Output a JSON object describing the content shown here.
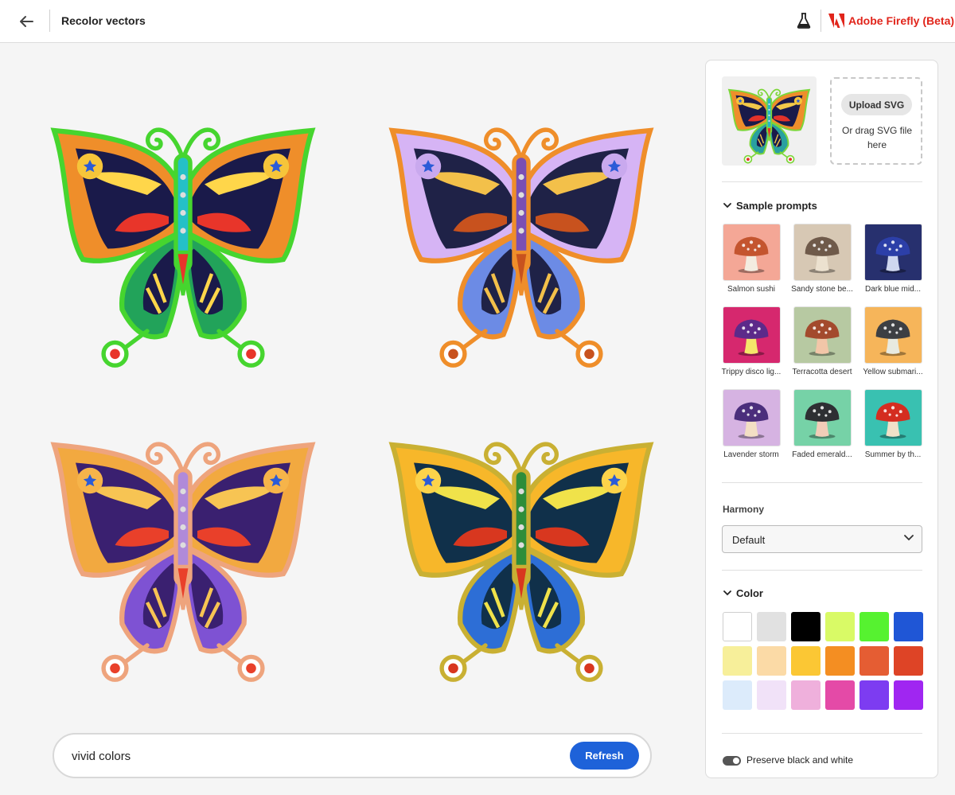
{
  "header": {
    "title": "Recolor vectors",
    "brand": "Adobe Firefly (Beta)",
    "brand_color": "#e1251b"
  },
  "icons": {
    "back": "arrow-left-icon",
    "labs": "flask-icon",
    "brand": "adobe-logo-icon",
    "section": "chevron-down-icon",
    "select": "chevron-down-icon"
  },
  "results": [
    {
      "outline": "#46d52f",
      "wing": "#ef8e2a",
      "dark": "#1a1a4a",
      "accent": "#e8352a",
      "lower": "#22a35a",
      "stripe": "#ffd64a",
      "body": "#25c0c7",
      "alt": "#f6c53a"
    },
    {
      "outline": "#ef8e2a",
      "wing": "#d6b4f5",
      "dark": "#1f2247",
      "accent": "#c8521e",
      "lower": "#6c8be5",
      "stripe": "#f3c04a",
      "body": "#7a4fb3",
      "alt": "#c9a9ee"
    },
    {
      "outline": "#eea47d",
      "wing": "#f2a940",
      "dark": "#3a2070",
      "accent": "#e9402a",
      "lower": "#7e52d3",
      "stripe": "#f7c453",
      "body": "#b08ad9",
      "alt": "#f6b44a"
    },
    {
      "outline": "#c9b033",
      "wing": "#f7b72a",
      "dark": "#10304a",
      "accent": "#d8371f",
      "lower": "#2d6ed6",
      "stripe": "#f0e24a",
      "body": "#2e8d3a",
      "alt": "#fcd34a"
    }
  ],
  "reference": {
    "outline": "#7dd63a",
    "wing": "#ee8e2b",
    "dark": "#1a1a4a",
    "accent": "#e3322a",
    "lower": "#2aa0a0",
    "stripe": "#f2c84a",
    "body": "#2ab8c0",
    "alt": "#f6c53a"
  },
  "upload": {
    "button_label": "Upload SVG",
    "hint": "Or drag SVG file here"
  },
  "sample_prompts": {
    "title": "Sample prompts",
    "items": [
      {
        "label": "Salmon sushi",
        "bg": "#f4a796",
        "cap": "#c4552f",
        "stem": "#f3ece0"
      },
      {
        "label": "Sandy stone be...",
        "bg": "#d7c8b4",
        "cap": "#6f5a4a",
        "stem": "#ece1cf"
      },
      {
        "label": "Dark blue mid...",
        "bg": "#27306e",
        "cap": "#2c3fa8",
        "stem": "#cfd7ef"
      },
      {
        "label": "Trippy disco lig...",
        "bg": "#d6286e",
        "cap": "#5c2a8a",
        "stem": "#f5e66a"
      },
      {
        "label": "Terracotta desert",
        "bg": "#b7c9a2",
        "cap": "#a34a2d",
        "stem": "#f2c6a8"
      },
      {
        "label": "Yellow submari...",
        "bg": "#f6b55a",
        "cap": "#3d3f43",
        "stem": "#e8eae0"
      },
      {
        "label": "Lavender storm",
        "bg": "#d6b3e2",
        "cap": "#4b2e7c",
        "stem": "#f3dfc4"
      },
      {
        "label": "Faded emerald...",
        "bg": "#76d2a7",
        "cap": "#2e2f33",
        "stem": "#f2cdb8"
      },
      {
        "label": "Summer by th...",
        "bg": "#39c1b1",
        "cap": "#d42d20",
        "stem": "#f0e1c8"
      }
    ]
  },
  "harmony": {
    "label": "Harmony",
    "selected": "Default"
  },
  "color": {
    "title": "Color",
    "swatches": [
      "#ffffff",
      "#e1e1e1",
      "#000000",
      "#d9fa66",
      "#56f230",
      "#1f56d6",
      "#f7ef9a",
      "#fbdaa6",
      "#fbc734",
      "#f48e22",
      "#e55d33",
      "#de4426",
      "#dcebfb",
      "#f1e2f8",
      "#efb0dc",
      "#e44aa7",
      "#7d3cf1",
      "#a026f1"
    ]
  },
  "preserve": {
    "label": "Preserve black and white",
    "enabled": true
  },
  "prompt": {
    "value": "vivid colors",
    "refresh_label": "Refresh"
  }
}
